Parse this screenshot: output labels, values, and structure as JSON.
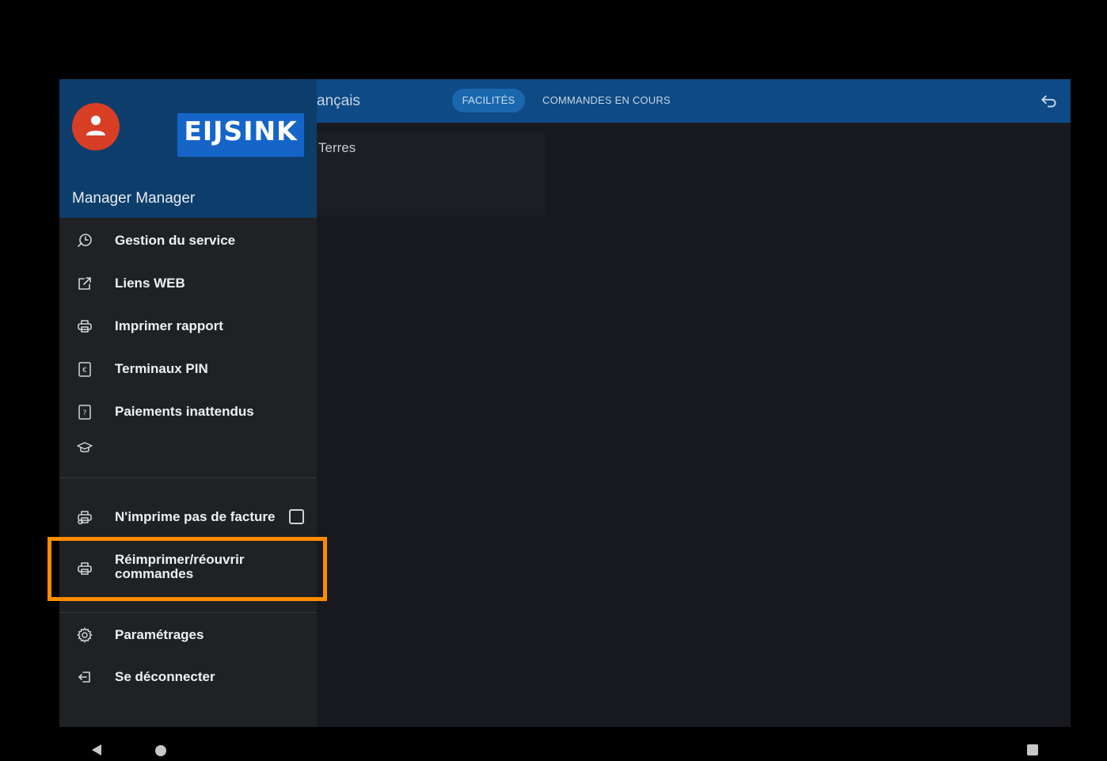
{
  "appbar": {
    "title_partial": "ançais",
    "tabs": [
      {
        "label": "FACILITÉS",
        "active": true
      },
      {
        "label": "COMMANDES EN COURS",
        "active": false
      }
    ]
  },
  "content": {
    "card_label": "Terres"
  },
  "drawer": {
    "logo_text": "EIJSINK",
    "user_name": "Manager Manager",
    "items": [
      {
        "label": "Gestion du service",
        "icon": "clock-history-icon"
      },
      {
        "label": "Liens WEB",
        "icon": "external-link-icon"
      },
      {
        "label": "Imprimer rapport",
        "icon": "printer-icon"
      },
      {
        "label": "Terminaux PIN",
        "icon": "euro-terminal-icon"
      },
      {
        "label": "Paiements inattendus",
        "icon": "question-terminal-icon"
      },
      {
        "label": "",
        "icon": "graduation-cap-icon"
      }
    ],
    "no_invoice_label": "N'imprime pas de facture",
    "no_invoice_checked": false,
    "reprint_label_line1": "Réimprimer/réouvrir",
    "reprint_label_line2": "commandes",
    "settings_label": "Paramétrages",
    "logout_label": "Se déconnecter"
  },
  "colors": {
    "appbar": "#0e4a85",
    "drawer_header": "#0d3d6a",
    "avatar": "#d83e24",
    "logo": "#1565c8",
    "highlight": "#ff8c00"
  }
}
